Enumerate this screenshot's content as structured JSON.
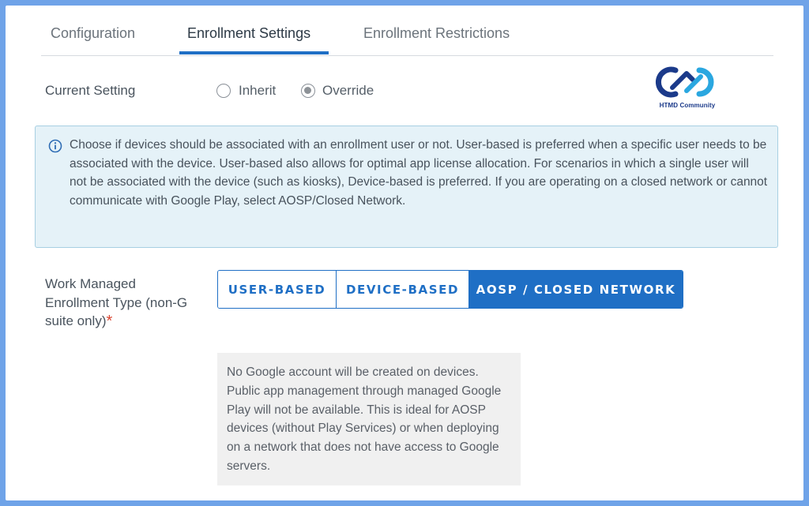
{
  "tabs": [
    {
      "label": "Configuration",
      "active": false
    },
    {
      "label": "Enrollment Settings",
      "active": true
    },
    {
      "label": "Enrollment Restrictions",
      "active": false
    }
  ],
  "current_setting": {
    "label": "Current Setting",
    "options": [
      {
        "label": "Inherit",
        "selected": false
      },
      {
        "label": "Override",
        "selected": true
      }
    ]
  },
  "logo": {
    "text": "HTMD Community"
  },
  "info": {
    "icon": "info-icon",
    "text": "Choose if devices should be associated with an enrollment user or not. User-based is preferred when a specific user needs to be associated with the device. User-based also allows for optimal app license allocation. For scenarios in which a single user will not be associated with the device (such as kiosks), Device-based is preferred. If you are operating on a closed network or cannot communicate with Google Play, select AOSP/Closed Network."
  },
  "enrollment_type": {
    "label": "Work Managed Enrollment Type (non-G suite only)",
    "required_mark": "*",
    "options": [
      {
        "label": "USER-BASED",
        "selected": false
      },
      {
        "label": "DEVICE-BASED",
        "selected": false
      },
      {
        "label": "AOSP / CLOSED NETWORK",
        "selected": true
      }
    ],
    "description": "No Google account will be created on devices. Public app management through managed Google Play will not be available. This is ideal for AOSP devices (without Play Services) or when deploying on a network that does not have access to Google servers."
  },
  "colors": {
    "accent": "#1f6fc5",
    "info_bg": "#e5f2f8",
    "info_border": "#a7cfe2",
    "required": "#d9432f",
    "frame_border": "#6fa3e8"
  }
}
